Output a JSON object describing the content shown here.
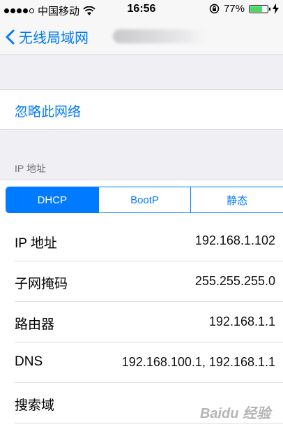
{
  "status_bar": {
    "carrier": "中国移动",
    "time": "16:56",
    "battery": "77%",
    "battery_level": 0.77
  },
  "nav": {
    "back_label": "无线局域网"
  },
  "forget_network": "忽略此网络",
  "section_header": "IP 地址",
  "segments": [
    "DHCP",
    "BootP",
    "静态"
  ],
  "selected_segment": "DHCP",
  "rows": [
    {
      "label": "IP 地址",
      "value": "192.168.1.102"
    },
    {
      "label": "子网掩码",
      "value": "255.255.255.0"
    },
    {
      "label": "路由器",
      "value": "192.168.1.1"
    },
    {
      "label": "DNS",
      "value": "192.168.100.1, 192.168.1.1"
    },
    {
      "label": "搜索域",
      "value": ""
    }
  ],
  "watermark": "Baidu 经验",
  "colors": {
    "accent": "#007aff",
    "battery": "#4cd964"
  }
}
